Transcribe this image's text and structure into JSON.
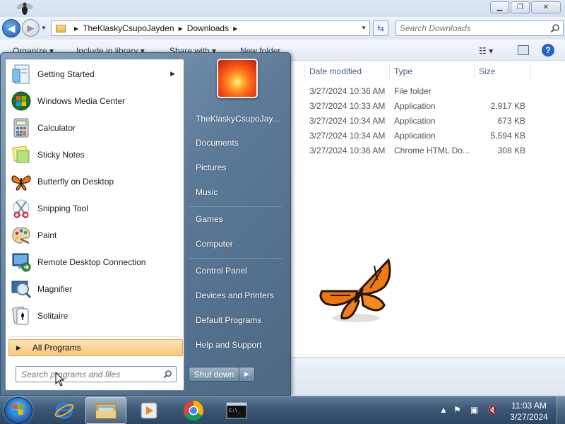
{
  "explorer": {
    "window_buttons": {
      "minimize": "▁",
      "maximize": "❐",
      "close": "✕"
    },
    "breadcrumb": [
      "TheKlaskyCsupoJayden",
      "Downloads"
    ],
    "search_placeholder": "Search Downloads",
    "toolbar": {
      "organize": "Organize ▾",
      "include": "Include in library ▾",
      "share": "Share with ▾",
      "new_folder": "New folder"
    },
    "columns": {
      "date": "Date modified",
      "type": "Type",
      "size": "Size"
    },
    "files": [
      {
        "date": "3/27/2024 10:36 AM",
        "type": "File folder",
        "size": ""
      },
      {
        "date": "3/27/2024 10:33 AM",
        "type": "Application",
        "size": "2,917 KB"
      },
      {
        "date": "3/27/2024 10:34 AM",
        "type": "Application",
        "size": "673 KB"
      },
      {
        "date": "3/27/2024 10:34 AM",
        "type": "Application",
        "size": "5,594 KB"
      },
      {
        "date": "3/27/2024 10:36 AM",
        "type": "Chrome HTML Do...",
        "size": "308 KB"
      }
    ]
  },
  "start_menu": {
    "programs": [
      {
        "label": "Getting Started",
        "icon": "getting-started-icon"
      },
      {
        "label": "Windows Media Center",
        "icon": "media-center-icon"
      },
      {
        "label": "Calculator",
        "icon": "calculator-icon"
      },
      {
        "label": "Sticky Notes",
        "icon": "sticky-notes-icon"
      },
      {
        "label": "Butterfly on Desktop",
        "icon": "butterfly-icon"
      },
      {
        "label": "Snipping Tool",
        "icon": "snipping-tool-icon"
      },
      {
        "label": "Paint",
        "icon": "paint-icon"
      },
      {
        "label": "Remote Desktop Connection",
        "icon": "remote-desktop-icon"
      },
      {
        "label": "Magnifier",
        "icon": "magnifier-icon"
      },
      {
        "label": "Solitaire",
        "icon": "solitaire-icon"
      }
    ],
    "all_programs": "All Programs",
    "search_placeholder": "Search programs and files",
    "right_items": [
      "TheKlaskyCsupoJay...",
      "Documents",
      "Pictures",
      "Music",
      "Games",
      "Computer",
      "Control Panel",
      "Devices and Printers",
      "Default Programs",
      "Help and Support"
    ],
    "shutdown": "Shut down"
  },
  "taskbar": {
    "clock_time": "11:03 AM",
    "clock_date": "3/27/2024"
  }
}
